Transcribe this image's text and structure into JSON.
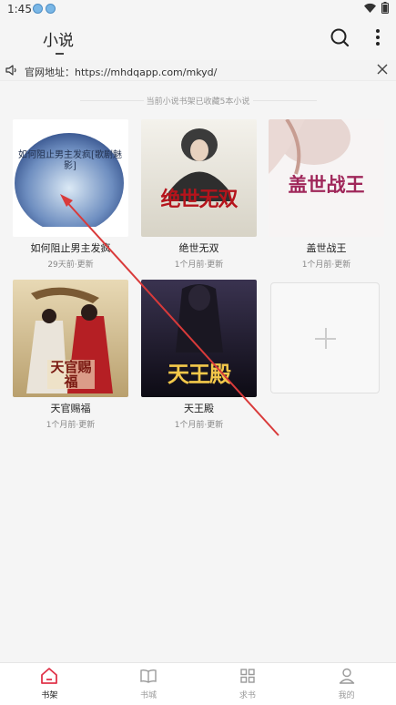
{
  "status": {
    "time": "1:45"
  },
  "header": {
    "title": "小说"
  },
  "notice": {
    "text": "官网地址：https://mhdqapp.com/mkyd/"
  },
  "shelf": {
    "info": "当前小说书架已收藏5本小说",
    "books": [
      {
        "title": "如何阻止男主发疯",
        "updated": "29天前·更新",
        "cover_text": "如何阻止男主发疯[歌剧魅影]"
      },
      {
        "title": "绝世无双",
        "updated": "1个月前·更新",
        "cover_text": "绝世无双"
      },
      {
        "title": "盖世战王",
        "updated": "1个月前·更新",
        "cover_text": "盖世战王"
      },
      {
        "title": "天官赐福",
        "updated": "1个月前·更新",
        "cover_text": "天官赐福"
      },
      {
        "title": "天王殿",
        "updated": "1个月前·更新",
        "cover_text": "天王殿"
      }
    ]
  },
  "nav": [
    {
      "label": "书架",
      "icon": "home-icon",
      "active": true
    },
    {
      "label": "书城",
      "icon": "book-icon",
      "active": false
    },
    {
      "label": "求书",
      "icon": "grid-icon",
      "active": false
    },
    {
      "label": "我的",
      "icon": "user-icon",
      "active": false
    }
  ],
  "colors": {
    "accent": "#e0344a",
    "annotation_arrow": "#d93a3a"
  }
}
